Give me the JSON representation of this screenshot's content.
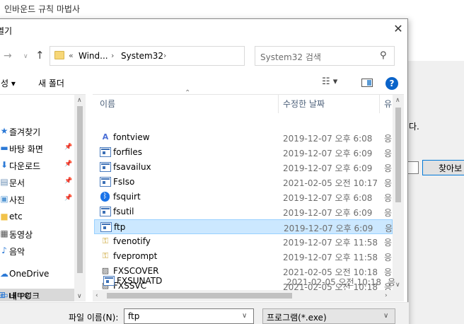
{
  "background": {
    "title": "인바운드 규칙 마법사",
    "partial_text": "다.",
    "button_label": "찾아보"
  },
  "dialog": {
    "title": "열기",
    "close_glyph": "✕"
  },
  "address_bar": {
    "overflow": "«",
    "segments": [
      "Wind...",
      "System32"
    ],
    "separator": "›"
  },
  "search": {
    "placeholder": "System32 검색"
  },
  "toolbar": {
    "organize_label": "성 ▾",
    "new_folder_label": "새 폴더"
  },
  "nav_pane": {
    "items": [
      {
        "label": "즐겨찾기",
        "icon": "star-icon",
        "pinned": false
      },
      {
        "label": "바탕 화면",
        "icon": "desktop-icon",
        "pinned": true
      },
      {
        "label": "다운로드",
        "icon": "download-icon",
        "pinned": true
      },
      {
        "label": "문서",
        "icon": "document-icon",
        "pinned": true
      },
      {
        "label": "사진",
        "icon": "pictures-icon",
        "pinned": true
      },
      {
        "label": "etc",
        "icon": "folder-icon",
        "pinned": false
      },
      {
        "label": "동영상",
        "icon": "video-icon",
        "pinned": false
      },
      {
        "label": "음악",
        "icon": "music-icon",
        "pinned": false
      },
      {
        "label": "OneDrive",
        "icon": "cloud-icon",
        "pinned": false
      },
      {
        "label": "내 PC",
        "icon": "pc-icon",
        "pinned": false,
        "selected": true
      },
      {
        "label": "네트워크",
        "icon": "network-icon",
        "pinned": false
      }
    ]
  },
  "columns": {
    "name": "이름",
    "date": "수정한 날짜",
    "type": "유"
  },
  "files": [
    {
      "name": "fontview",
      "date": "2019-12-07 오후 6:08",
      "type": "응",
      "icon": "fontview-icon"
    },
    {
      "name": "forfiles",
      "date": "2019-12-07 오후 6:09",
      "type": "응",
      "icon": "exe-icon"
    },
    {
      "name": "fsavailux",
      "date": "2019-12-07 오후 6:09",
      "type": "응",
      "icon": "exe-icon"
    },
    {
      "name": "FsIso",
      "date": "2021-02-05 오전 10:17",
      "type": "응",
      "icon": "exe-icon"
    },
    {
      "name": "fsquirt",
      "date": "2019-12-07 오후 6:08",
      "type": "응",
      "icon": "bluetooth-icon"
    },
    {
      "name": "fsutil",
      "date": "2019-12-07 오후 6:09",
      "type": "응",
      "icon": "exe-icon"
    },
    {
      "name": "ftp",
      "date": "2019-12-07 오후 6:09",
      "type": "응",
      "icon": "exe-icon",
      "selected": true
    },
    {
      "name": "fvenotify",
      "date": "2019-12-07 오후 11:58",
      "type": "응",
      "icon": "key-icon"
    },
    {
      "name": "fveprompt",
      "date": "2019-12-07 오후 11:58",
      "type": "응",
      "icon": "key-icon"
    },
    {
      "name": "FXSCOVER",
      "date": "2021-02-05 오전 10:18",
      "type": "응",
      "icon": "fax-icon"
    },
    {
      "name": "FXSSVC",
      "date": "2021-02-05 오전 10:18",
      "type": "응",
      "icon": "fax-icon"
    },
    {
      "name": "FXSUNATD",
      "date": "2021-02-05 오전 10:18",
      "type": "응",
      "icon": "exe-icon"
    }
  ],
  "bottom": {
    "filename_label": "파일 이름(N):",
    "filename_value": "ftp",
    "filter_value": "프로그램(*.exe)"
  },
  "colors": {
    "selection_bg": "#cce8ff",
    "selection_border": "#99d1ff",
    "help_blue": "#0a63c9",
    "header_text": "#4c607a"
  }
}
